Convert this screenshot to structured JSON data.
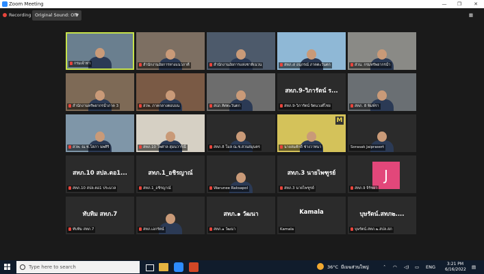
{
  "window": {
    "title": "Zoom Meeting"
  },
  "topbar": {
    "recording_label": "Recording",
    "sound_label": "Original Sound: Off",
    "view_label": ""
  },
  "tiles": [
    {
      "label": "กรมเจ้าท่า",
      "bg": "#6a7f8f",
      "speaking": true
    },
    {
      "label": "สำนักงานอัยการทางแนวภาคี",
      "bg": "#7d6f62"
    },
    {
      "label": "สำนักงานอัยการแห่งชาติเนวน",
      "bg": "#4d5a6b"
    },
    {
      "label": "สทภ.๕ อนุกรณ์ ภาคตะวันตก",
      "bg": "#8fb8d6"
    },
    {
      "label": "ส่วน. กรมทรัพยากรน้ำ",
      "bg": "#8a8a86"
    },
    {
      "label": "สำนักงานทรัพยากรน้ำภาค 3",
      "bg": "#7e6a56"
    },
    {
      "label": "สวพ. ภาคกลางตอนบน",
      "bg": "#7a5a45"
    },
    {
      "label": "สปภ.ทิศตะวันตก",
      "bg": "#6d6d6d"
    },
    {
      "label": "สทภ.9-วิภารัตน์ จิตนวงศ์ไชย",
      "bg": "#2b2b2b",
      "big": "สทภ.9-วิภารัตน์ ร..."
    },
    {
      "label": "สทภ. 8 พิมพ์รา",
      "bg": "#6a6f73"
    },
    {
      "label": "สวพ. ณ.ช.โสภา นพศิริ",
      "bg": "#7f96a8"
    },
    {
      "label": "สทภ.10 ไพศาล สุมนวาร์ณี",
      "bg": "#d6d0c4"
    },
    {
      "label": "สทภ.8 โมล ณ.ช.สวนสมุนตร",
      "bg": "#2b2b2b"
    },
    {
      "label": "นายสมศักดิ์ ช่างวาทนา",
      "bg": "#d4c25a",
      "logo": "M"
    },
    {
      "label": "Sorasak Jaiprasert",
      "bg": "#2b2b2b",
      "plain": true
    },
    {
      "label": "สทภ.10 สปล.ตอ1 ประมวล",
      "bg": "#2b2b2b",
      "big": "สทภ.10 สปล.ตอ1..."
    },
    {
      "label": "สทภ.1_อชิรญาณ์",
      "bg": "#2b2b2b",
      "big": "สทภ.1_อชิรญาณ์"
    },
    {
      "label": "Warunee Raksapol",
      "bg": "#2b2b2b"
    },
    {
      "label": "สทภ.3 นายไพฑูรย์",
      "bg": "#2b2b2b",
      "big": "สทภ.3 นายไพฑูรย์"
    },
    {
      "label": "สทภ.9 จิรัชยา",
      "bg": "#2b2b2b",
      "letter": "J"
    },
    {
      "label": "ทับทิม สทภ.7",
      "bg": "#2b2b2b",
      "big": "ทับทิม สทภ.7"
    },
    {
      "label": "สทภ.เอกรัตน์",
      "bg": "#2b2b2b"
    },
    {
      "label": "สทภ.๑ วัฒนา",
      "bg": "#2b2b2b",
      "big": "สทภ.๑ วัฒนา"
    },
    {
      "label": "Kamala",
      "bg": "#2b2b2b",
      "big": "Kamala",
      "plain": true
    },
    {
      "label": "บุษรัตน์.สทภ.๒.สปล.สภ",
      "bg": "#2b2b2b",
      "big": "บุษรัตน์.สทภ๒...."
    }
  ],
  "taskbar": {
    "search_placeholder": "Type here to search",
    "weather": "36°C",
    "weather_desc": "มีเมฆส่วนใหญ่",
    "lang": "ENG",
    "time": "3:21 PM",
    "date": "6/16/2022"
  },
  "colors": {
    "accent": "#c7e34b",
    "zoom_blue": "#2d8cff",
    "recording_red": "#e8453c"
  }
}
